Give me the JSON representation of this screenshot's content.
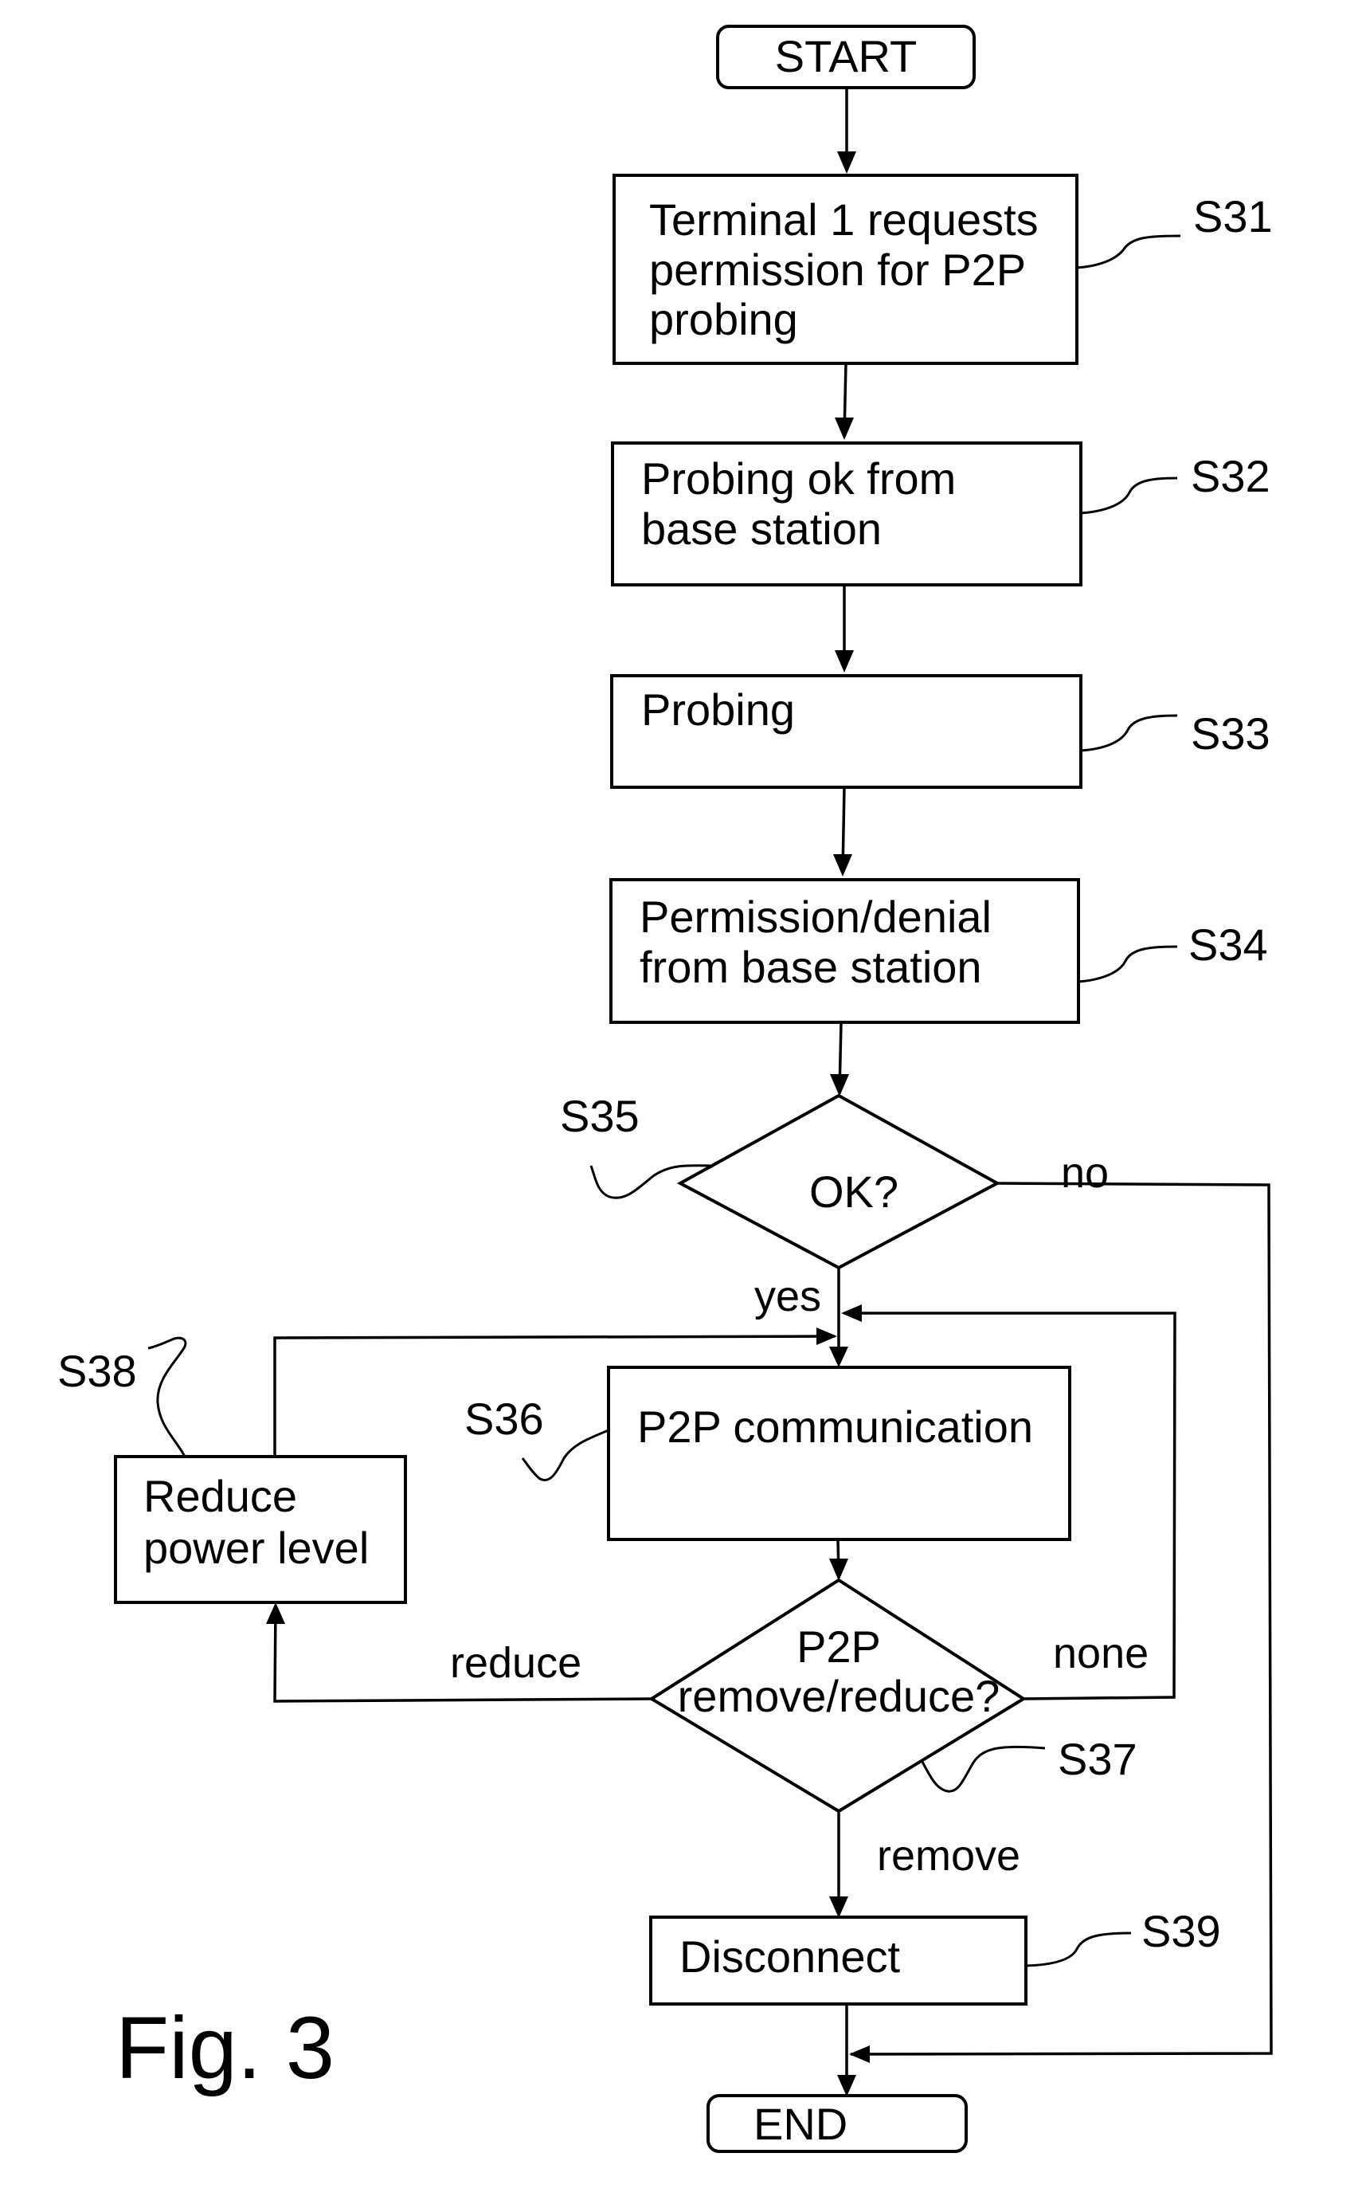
{
  "figure": {
    "label": "Fig. 3"
  },
  "nodes": {
    "start": {
      "label": "START"
    },
    "s31": {
      "ref": "S31",
      "lines": [
        "Terminal 1 requests",
        "permission for P2P",
        "probing"
      ]
    },
    "s32": {
      "ref": "S32",
      "lines": [
        "Probing ok from",
        "base station"
      ]
    },
    "s33": {
      "ref": "S33",
      "lines": [
        "Probing"
      ]
    },
    "s34": {
      "ref": "S34",
      "lines": [
        "Permission/denial",
        "from base station"
      ]
    },
    "s35": {
      "ref": "S35",
      "lines": [
        "OK?"
      ]
    },
    "s36": {
      "ref": "S36",
      "lines": [
        "P2P communication"
      ]
    },
    "s37": {
      "ref": "S37",
      "lines": [
        "P2P",
        "remove/reduce?"
      ]
    },
    "s38": {
      "ref": "S38",
      "lines": [
        "Reduce",
        "power level"
      ]
    },
    "s39": {
      "ref": "S39",
      "lines": [
        "Disconnect"
      ]
    },
    "end": {
      "label": "END"
    }
  },
  "branches": {
    "s35_no": "no",
    "s35_yes": "yes",
    "s37_reduce": "reduce",
    "s37_none": "none",
    "s37_remove": "remove"
  }
}
